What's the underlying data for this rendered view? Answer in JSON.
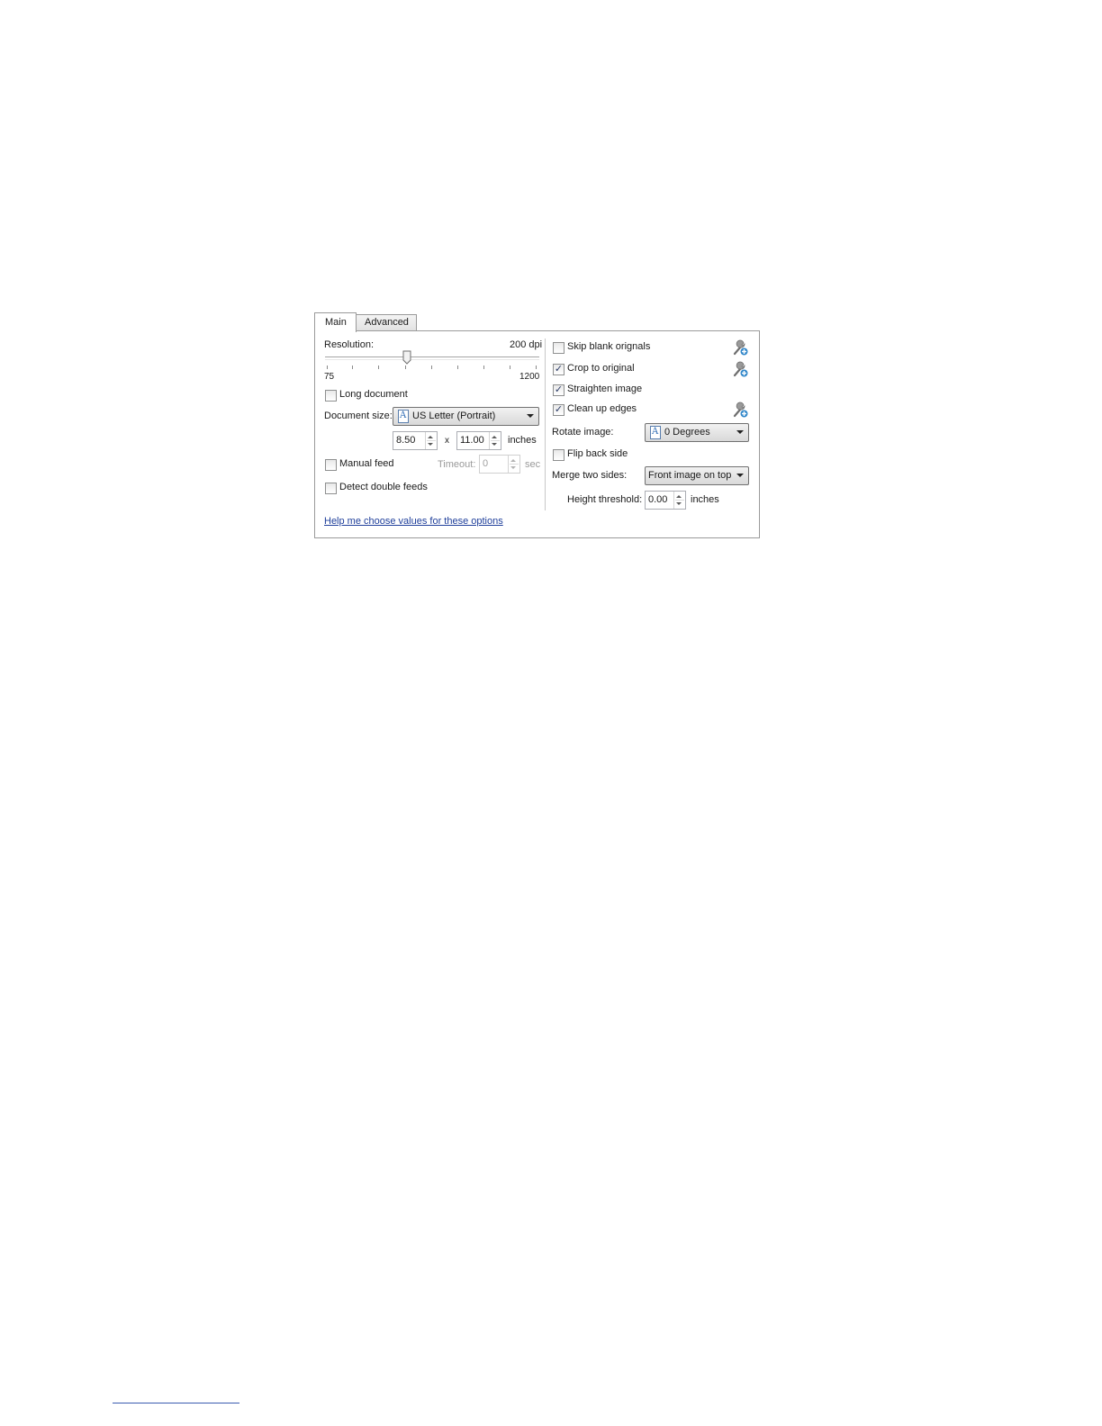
{
  "tabs": [
    {
      "label": "Main"
    },
    {
      "label": "Advanced"
    }
  ],
  "left": {
    "resolution": {
      "label": "Resolution:",
      "value_text": "200 dpi",
      "min_label": "75",
      "max_label": "1200",
      "min": 75,
      "max": 1200,
      "value": 200
    },
    "long_document": {
      "label": "Long document",
      "checked": false
    },
    "document_size": {
      "label": "Document size:",
      "selected": "US Letter (Portrait)",
      "width": "8.50",
      "times": "x",
      "height": "11.00",
      "unit": "inches"
    },
    "manual_feed": {
      "label": "Manual feed",
      "checked": false
    },
    "timeout": {
      "label": "Timeout:",
      "value": "0",
      "unit": "sec"
    },
    "detect_double_feeds": {
      "label": "Detect double feeds",
      "checked": false
    },
    "help_link": "Help me choose values for these options"
  },
  "right": {
    "skip_blank": {
      "label": "Skip blank orignals",
      "checked": false
    },
    "crop": {
      "label": "Crop to original",
      "checked": true
    },
    "straighten": {
      "label": "Straighten image",
      "checked": true
    },
    "clean_edges": {
      "label": "Clean up edges",
      "checked": true
    },
    "rotate": {
      "label": "Rotate image:",
      "selected": "0 Degrees"
    },
    "flip_back": {
      "label": "Flip back side",
      "checked": false
    },
    "merge": {
      "label": "Merge two sides:",
      "selected": "Front image on top"
    },
    "height_threshold": {
      "label": "Height threshold:",
      "value": "0.00",
      "unit": "inches"
    }
  },
  "check_glyph": "✓",
  "icons": {
    "wrench": "wrench-settings-icon",
    "document": "document-icon",
    "dropdown": "chevron-down-icon"
  },
  "colors": {
    "link": "#1e3e9a",
    "border": "#9a9a9a",
    "check": "#2a3b66"
  }
}
